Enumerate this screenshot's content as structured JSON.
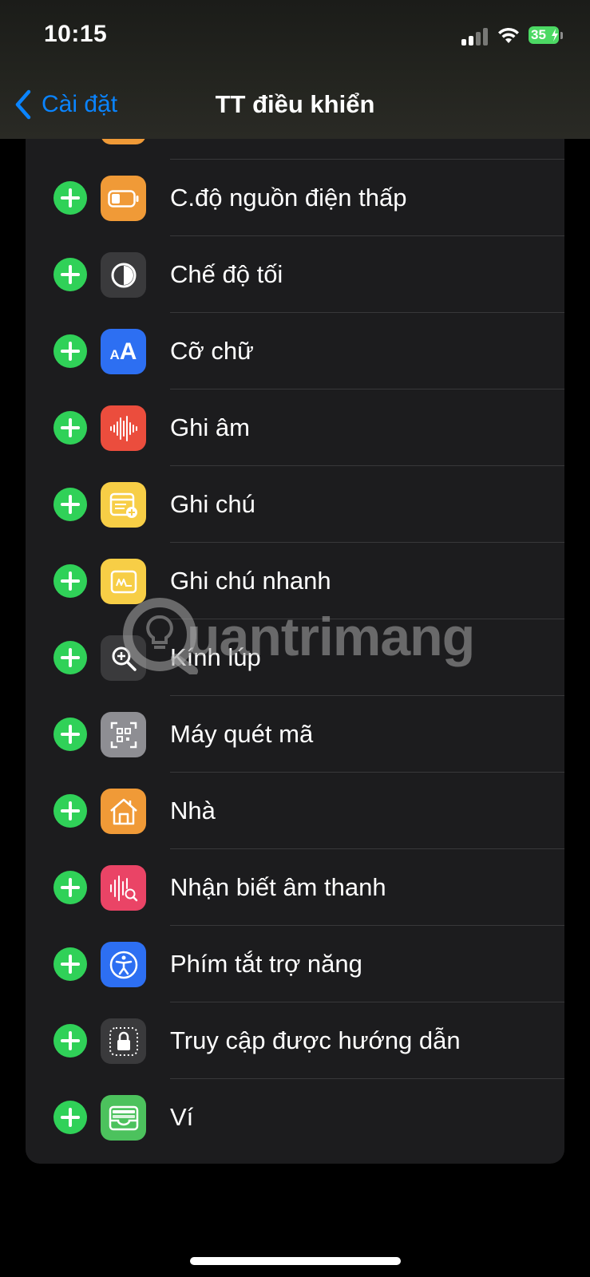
{
  "status_bar": {
    "time": "10:15",
    "battery": "35"
  },
  "nav": {
    "back_label": "Cài đặt",
    "title": "TT điều khiển"
  },
  "items": [
    {
      "label": "C.độ nguồn điện thấp",
      "icon": "low-power-battery-icon",
      "color": "#f09a37"
    },
    {
      "label": "Chế độ tối",
      "icon": "dark-mode-icon",
      "color": "#3a3a3c"
    },
    {
      "label": "Cỡ chữ",
      "icon": "text-size-icon",
      "color": "#2d6ff2"
    },
    {
      "label": "Ghi âm",
      "icon": "voice-memo-waveform-icon",
      "color": "#eb4d3d"
    },
    {
      "label": "Ghi chú",
      "icon": "notes-icon",
      "color": "#f7ce46"
    },
    {
      "label": "Ghi chú nhanh",
      "icon": "quick-note-icon",
      "color": "#f7ce46"
    },
    {
      "label": "Kính lúp",
      "icon": "magnifier-icon",
      "color": "#3a3a3c"
    },
    {
      "label": "Máy quét mã",
      "icon": "qr-code-scanner-icon",
      "color": "#8e8e93"
    },
    {
      "label": "Nhà",
      "icon": "home-icon",
      "color": "#f09a37"
    },
    {
      "label": "Nhận biết âm thanh",
      "icon": "sound-recognition-icon",
      "color": "#ea4466"
    },
    {
      "label": "Phím tắt trợ năng",
      "icon": "accessibility-icon",
      "color": "#2d6ff2"
    },
    {
      "label": "Truy cập được hướng dẫn",
      "icon": "guided-access-lock-icon",
      "color": "#3a3a3c"
    },
    {
      "label": "Ví",
      "icon": "wallet-icon",
      "color": "#4cc25d"
    }
  ],
  "colors": {
    "accent": "#0a84ff",
    "add_button": "#30d158",
    "card_bg": "#1c1c1e"
  },
  "watermark": {
    "text": "uantrimang"
  }
}
